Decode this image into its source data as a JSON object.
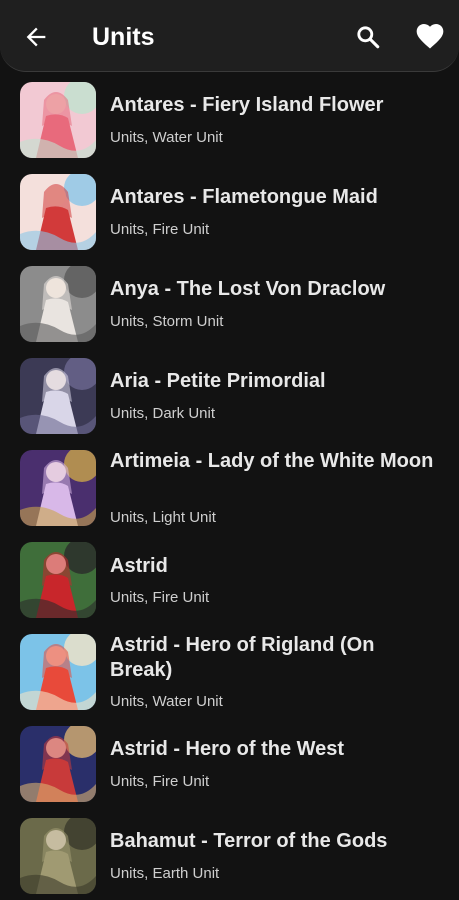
{
  "header": {
    "title": "Units",
    "back_icon": "arrow-left-icon",
    "search_icon": "search-icon",
    "favorite_icon": "heart-icon"
  },
  "units": [
    {
      "name": "Antares - Fiery Island Flower",
      "subtitle": "Units, Water Unit",
      "colors": [
        "#f2c9d3",
        "#e86a7c",
        "#bfe3d0"
      ]
    },
    {
      "name": "Antares - Flametongue Maid",
      "subtitle": "Units, Fire Unit",
      "colors": [
        "#f4e0dc",
        "#d23a3a",
        "#8ac6e8"
      ]
    },
    {
      "name": "Anya - The Lost Von Draclow",
      "subtitle": "Units, Storm Unit",
      "colors": [
        "#8c8c8c",
        "#e9e4e0",
        "#5a5a5a"
      ]
    },
    {
      "name": "Aria - Petite Primordial",
      "subtitle": "Units, Dark Unit",
      "colors": [
        "#3c3a55",
        "#d9d6e8",
        "#6b6890"
      ]
    },
    {
      "name": "Artimeia - Lady of the White Moon",
      "subtitle": "Units, Light Unit",
      "colors": [
        "#4a2f6e",
        "#d8b8e8",
        "#c9a54a"
      ]
    },
    {
      "name": "Astrid",
      "subtitle": "Units, Fire Unit",
      "colors": [
        "#3f6e3a",
        "#c8262b",
        "#2b2b2b"
      ]
    },
    {
      "name": "Astrid - Hero of Rigland (On Break)",
      "subtitle": "Units, Water Unit",
      "colors": [
        "#7cc3e8",
        "#e84a3a",
        "#f2e3c6"
      ]
    },
    {
      "name": "Astrid - Hero of the West",
      "subtitle": "Units, Fire Unit",
      "colors": [
        "#2a2f6a",
        "#c83a3a",
        "#d8b070"
      ]
    },
    {
      "name": "Bahamut - Terror of the Gods",
      "subtitle": "Units, Earth Unit",
      "colors": [
        "#6b6a4a",
        "#a09a72",
        "#3a3a2a"
      ]
    }
  ]
}
